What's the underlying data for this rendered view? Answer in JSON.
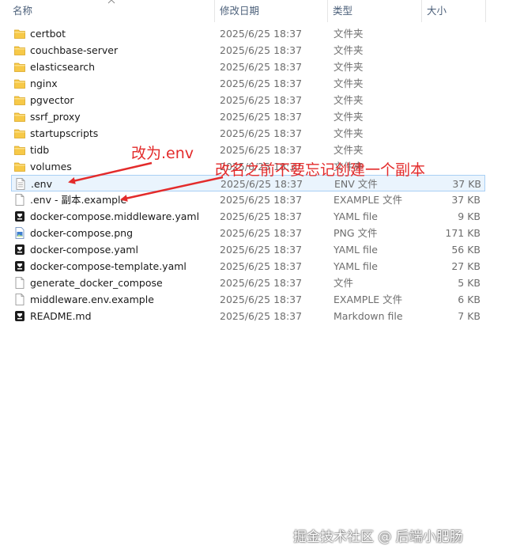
{
  "header": {
    "name": "名称",
    "date": "修改日期",
    "type": "类型",
    "size": "大小"
  },
  "files": [
    {
      "name": "certbot",
      "date": "2025/6/25 18:37",
      "type": "文件夹",
      "size": "",
      "icon": "folder-icon"
    },
    {
      "name": "couchbase-server",
      "date": "2025/6/25 18:37",
      "type": "文件夹",
      "size": "",
      "icon": "folder-icon"
    },
    {
      "name": "elasticsearch",
      "date": "2025/6/25 18:37",
      "type": "文件夹",
      "size": "",
      "icon": "folder-icon"
    },
    {
      "name": "nginx",
      "date": "2025/6/25 18:37",
      "type": "文件夹",
      "size": "",
      "icon": "folder-icon"
    },
    {
      "name": "pgvector",
      "date": "2025/6/25 18:37",
      "type": "文件夹",
      "size": "",
      "icon": "folder-icon"
    },
    {
      "name": "ssrf_proxy",
      "date": "2025/6/25 18:37",
      "type": "文件夹",
      "size": "",
      "icon": "folder-icon"
    },
    {
      "name": "startupscripts",
      "date": "2025/6/25 18:37",
      "type": "文件夹",
      "size": "",
      "icon": "folder-icon"
    },
    {
      "name": "tidb",
      "date": "2025/6/25 18:37",
      "type": "文件夹",
      "size": "",
      "icon": "folder-icon"
    },
    {
      "name": "volumes",
      "date": "2025/6/25 18:37",
      "type": "文件夹",
      "size": "",
      "icon": "folder-icon"
    },
    {
      "name": ".env",
      "date": "2025/6/25 18:37",
      "type": "ENV 文件",
      "size": "37 KB",
      "icon": "text-file-icon",
      "selected": true
    },
    {
      "name": ".env - 副本.example",
      "date": "2025/6/25 18:37",
      "type": "EXAMPLE 文件",
      "size": "37 KB",
      "icon": "blank-file-icon"
    },
    {
      "name": "docker-compose.middleware.yaml",
      "date": "2025/6/25 18:37",
      "type": "YAML file",
      "size": "9 KB",
      "icon": "app-file-icon"
    },
    {
      "name": "docker-compose.png",
      "date": "2025/6/25 18:37",
      "type": "PNG 文件",
      "size": "171 KB",
      "icon": "image-file-icon"
    },
    {
      "name": "docker-compose.yaml",
      "date": "2025/6/25 18:37",
      "type": "YAML file",
      "size": "56 KB",
      "icon": "app-file-icon"
    },
    {
      "name": "docker-compose-template.yaml",
      "date": "2025/6/25 18:37",
      "type": "YAML file",
      "size": "27 KB",
      "icon": "app-file-icon"
    },
    {
      "name": "generate_docker_compose",
      "date": "2025/6/25 18:37",
      "type": "文件",
      "size": "5 KB",
      "icon": "blank-file-icon"
    },
    {
      "name": "middleware.env.example",
      "date": "2025/6/25 18:37",
      "type": "EXAMPLE 文件",
      "size": "6 KB",
      "icon": "blank-file-icon"
    },
    {
      "name": "README.md",
      "date": "2025/6/25 18:37",
      "type": "Markdown file",
      "size": "7 KB",
      "icon": "app-file-icon"
    }
  ],
  "annotations": {
    "rename_note": "改为.env",
    "copy_note": "改名之前不要忘记创建一个副本"
  },
  "watermark": "掘金技术社区 @ 后端小肥肠",
  "colors": {
    "annotation_red": "#e32b2b",
    "folder_yellow": "#f7c948",
    "header_text": "#4c607a",
    "selection_border": "#a9d0f5"
  }
}
